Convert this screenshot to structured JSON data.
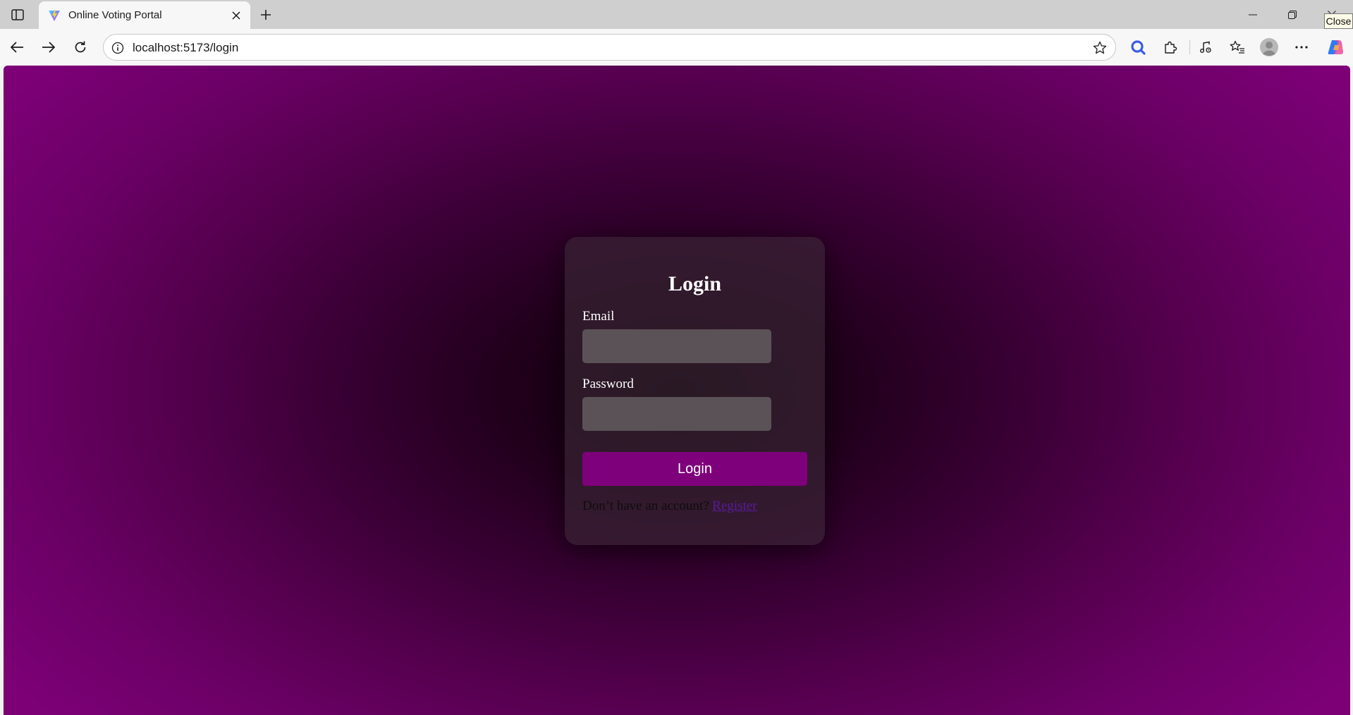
{
  "browser": {
    "tab": {
      "title": "Online Voting Portal",
      "favicon": "vite-logo-icon"
    },
    "address_bar": {
      "url": "localhost:5173/login"
    },
    "tooltip": "Close",
    "icons": {
      "sidebar": "sidebar-toggle-icon",
      "back": "back-arrow-icon",
      "forward": "forward-arrow-icon",
      "reload": "reload-icon",
      "info": "info-icon",
      "favorite": "star-icon",
      "search": "search-icon",
      "extensions": "puzzle-icon",
      "media": "music-note-icon",
      "favorites": "favorites-list-icon",
      "profile": "profile-avatar-icon",
      "menu": "more-dots-icon",
      "copilot": "copilot-icon"
    }
  },
  "page": {
    "heading": "Login",
    "email_label": "Email",
    "email_value": "",
    "password_label": "Password",
    "password_value": "",
    "submit_label": "Login",
    "register_prompt": "Don’t have an account?",
    "register_link": "Register"
  },
  "colors": {
    "background_edge": "#7d0077",
    "background_center": "#0c0008",
    "button": "#7e007b",
    "link": "#5a1a9e"
  }
}
